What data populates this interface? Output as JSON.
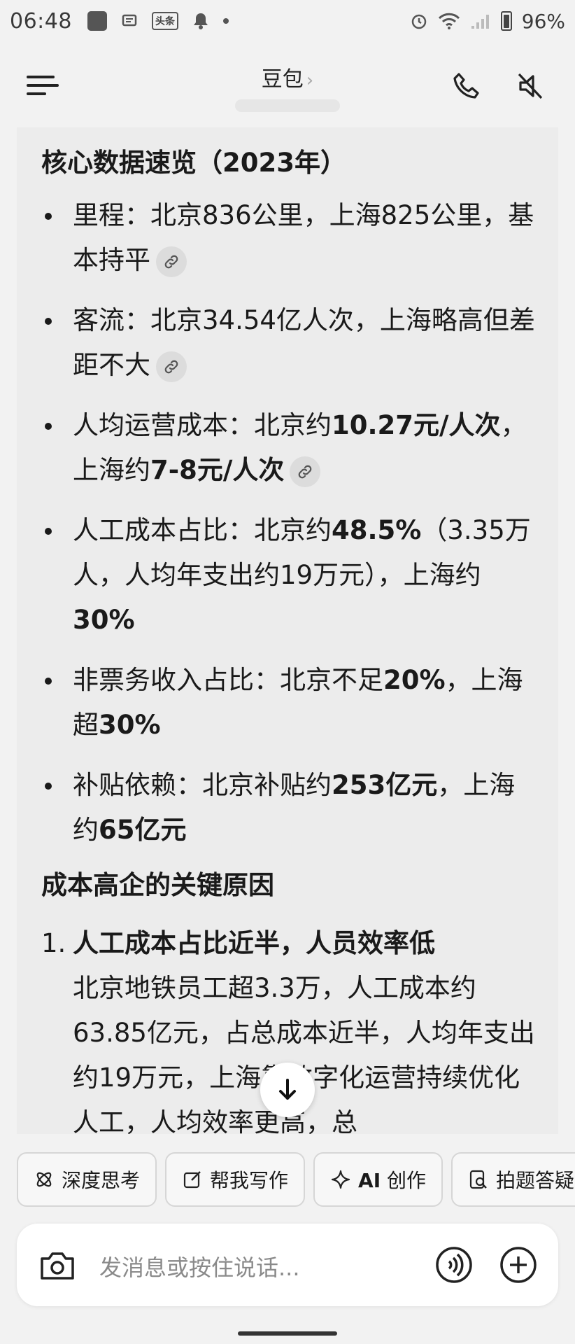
{
  "status_bar": {
    "time": "06:48",
    "app_badge": "头条",
    "battery": "96%"
  },
  "header": {
    "title": "豆包",
    "title_chevron": "›"
  },
  "content": {
    "section1_title": "核心数据速览（2023年）",
    "bullets": [
      {
        "pre": "里程：北京836公里，上海825公里，基本持平",
        "bold": "",
        "post": "",
        "bold2": "",
        "post2": "",
        "has_link": true
      },
      {
        "pre": "客流：北京34.54亿人次，上海略高但差距不大",
        "bold": "",
        "post": "",
        "bold2": "",
        "post2": "",
        "has_link": true
      },
      {
        "pre": "人均运营成本：北京约",
        "bold": "10.27元/人次",
        "post": "，上海约",
        "bold2": "7-8元/人次",
        "post2": "",
        "has_link": true
      },
      {
        "pre": "人工成本占比：北京约",
        "bold": "48.5%",
        "post": "（3.35万人，人均年支出约19万元），上海约",
        "bold2": "30%",
        "post2": "",
        "has_link": false
      },
      {
        "pre": "非票务收入占比：北京不足",
        "bold": "20%",
        "post": "，上海超",
        "bold2": "30%",
        "post2": "",
        "has_link": false
      },
      {
        "pre": "补贴依赖：北京补贴约",
        "bold": "253亿元",
        "post": "，上海约",
        "bold2": "65亿元",
        "post2": "",
        "has_link": false
      }
    ],
    "section2_title": "成本高企的关键原因",
    "numbered": [
      {
        "num": "1.",
        "title": "人工成本占比近半，人员效率低",
        "body": "北京地铁员工超3.3万，人工成本约63.85亿元，占总成本近半，人均年支出约19万元，上海靠数字化运营持续优化人工，人均效率更高，总"
      }
    ]
  },
  "chips": [
    {
      "icon": "atom-icon",
      "label": "深度思考"
    },
    {
      "icon": "edit-icon",
      "label": "帮我写作"
    },
    {
      "icon": "sparkle-icon",
      "label_bold": "AI",
      "label": " 创作"
    },
    {
      "icon": "photo-search-icon",
      "label": "拍题答疑"
    }
  ],
  "input": {
    "placeholder": "发消息或按住说话..."
  }
}
